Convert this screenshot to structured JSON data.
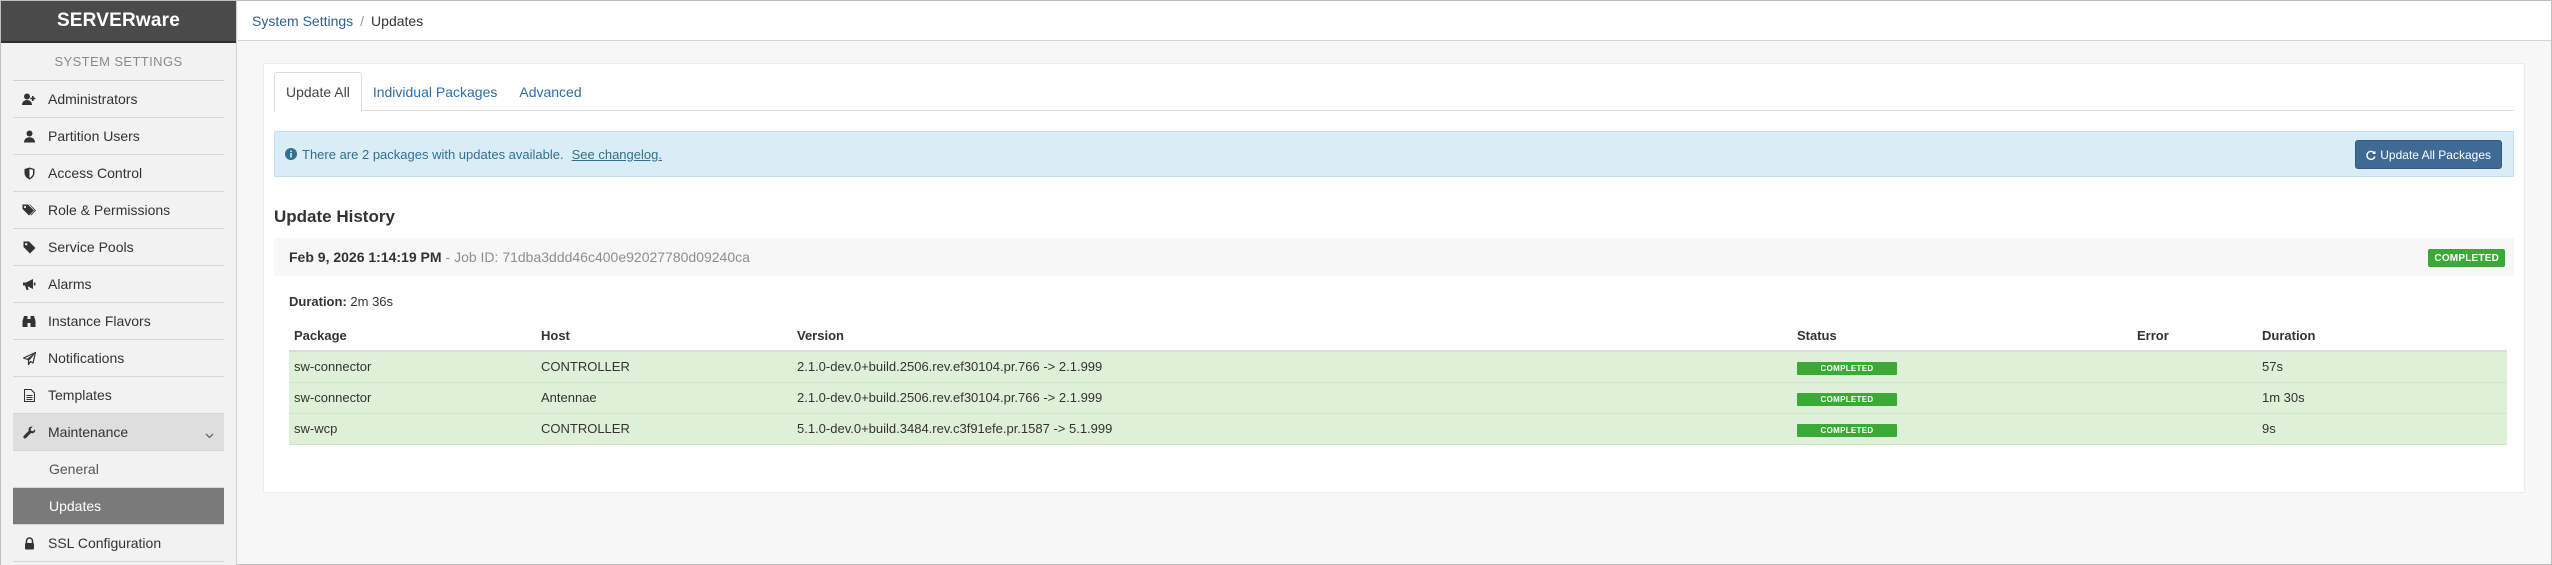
{
  "brand": "SERVERware",
  "sidebar": {
    "section_title": "SYSTEM SETTINGS",
    "items": [
      {
        "label": "Administrators",
        "icon": "user-plus-icon"
      },
      {
        "label": "Partition Users",
        "icon": "user-icon"
      },
      {
        "label": "Access Control",
        "icon": "shield-icon"
      },
      {
        "label": "Role & Permissions",
        "icon": "tags-icon"
      },
      {
        "label": "Service Pools",
        "icon": "tag-icon"
      },
      {
        "label": "Alarms",
        "icon": "bullhorn-icon"
      },
      {
        "label": "Instance Flavors",
        "icon": "binoculars-icon"
      },
      {
        "label": "Notifications",
        "icon": "paper-plane-icon"
      },
      {
        "label": "Templates",
        "icon": "file-text-icon"
      },
      {
        "label": "Maintenance",
        "icon": "wrench-icon"
      },
      {
        "label": "SSL Configuration",
        "icon": "lock-icon"
      }
    ],
    "maintenance_sub": [
      {
        "label": "General"
      },
      {
        "label": "Updates"
      }
    ]
  },
  "breadcrumb": {
    "parent": "System Settings",
    "separator": "/",
    "current": "Updates"
  },
  "tabs": [
    {
      "label": "Update All"
    },
    {
      "label": "Individual Packages"
    },
    {
      "label": "Advanced"
    }
  ],
  "alert": {
    "message": "There are 2 packages with updates available.",
    "link": "See changelog.",
    "button": "Update All Packages"
  },
  "history": {
    "title": "Update History",
    "job": {
      "date": "Feb 9, 2026 1:14:19 PM",
      "job_id_text": "- Job ID: 71dba3ddd46c400e92027780d09240ca",
      "status": "COMPLETED",
      "duration_label": "Duration:",
      "duration_value": "2m 36s"
    },
    "columns": [
      "Package",
      "Host",
      "Version",
      "Status",
      "Error",
      "Duration"
    ],
    "rows": [
      {
        "package": "sw-connector",
        "host": "CONTROLLER",
        "version": "2.1.0-dev.0+build.2506.rev.ef30104.pr.766 -> 2.1.999",
        "status": "COMPLETED",
        "error": "",
        "duration": "57s"
      },
      {
        "package": "sw-connector",
        "host": "Antennae",
        "version": "2.1.0-dev.0+build.2506.rev.ef30104.pr.766 -> 2.1.999",
        "status": "COMPLETED",
        "error": "",
        "duration": "1m 30s"
      },
      {
        "package": "sw-wcp",
        "host": "CONTROLLER",
        "version": "5.1.0-dev.0+build.3484.rev.c3f91efe.pr.1587 -> 5.1.999",
        "status": "COMPLETED",
        "error": "",
        "duration": "9s"
      }
    ]
  },
  "colors": {
    "brand_bg": "#4a4a4a",
    "link": "#2f6ea3",
    "alert_bg": "#d9edf7",
    "button_bg": "#3e6a94",
    "success": "#3aa935",
    "row_success": "#dff0d8"
  }
}
